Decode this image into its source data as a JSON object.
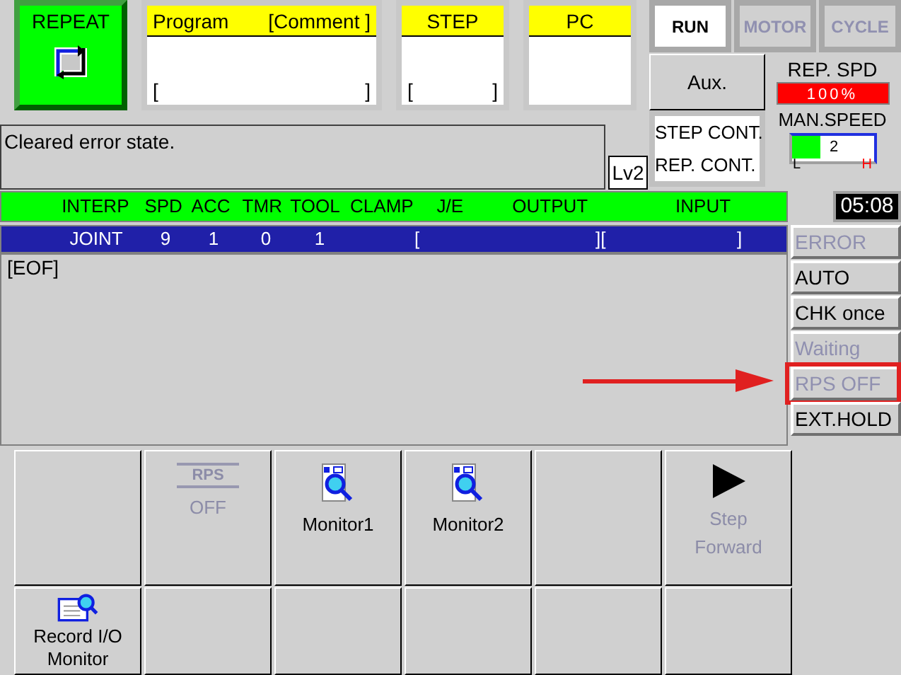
{
  "mode": {
    "label": "REPEAT"
  },
  "fields": [
    {
      "title": "Program",
      "comment": "[Comment ]",
      "open": "[",
      "close": "]"
    },
    {
      "title": "STEP",
      "open": "[",
      "close": "]"
    },
    {
      "title": "PC"
    }
  ],
  "status_buttons": [
    {
      "label": "RUN",
      "active": true
    },
    {
      "label": "MOTOR",
      "active": false
    },
    {
      "label": "CYCLE",
      "active": false
    }
  ],
  "aux": "Aux.",
  "cont_modes": [
    "STEP CONT.",
    "REP. CONT."
  ],
  "rep_speed": {
    "label": "REP. SPD",
    "value": "100%"
  },
  "man_speed": {
    "label": "MAN.SPEED",
    "value": "2",
    "level": 0.35,
    "low": "L",
    "high": "H"
  },
  "message": "Cleared error state.",
  "user_level": "Lv2",
  "table": {
    "columns": [
      "INTERP",
      "SPD",
      "ACC",
      "TMR",
      "TOOL",
      "CLAMP",
      "J/E",
      "OUTPUT",
      "INPUT"
    ],
    "row": {
      "cells": [
        "JOINT",
        "9",
        "1",
        "0",
        "1"
      ],
      "brackets": [
        "[",
        "][",
        "]"
      ]
    },
    "end": "[EOF]"
  },
  "clock": "05:08",
  "indicators": [
    {
      "label": "ERROR",
      "enabled": false,
      "highlighted": false
    },
    {
      "label": "AUTO",
      "enabled": true,
      "highlighted": false
    },
    {
      "label": "CHK once",
      "enabled": true,
      "highlighted": false
    },
    {
      "label": "Waiting",
      "enabled": false,
      "highlighted": false
    },
    {
      "label": "RPS OFF",
      "enabled": false,
      "highlighted": true
    },
    {
      "label": "EXT.HOLD",
      "enabled": true,
      "highlighted": false
    }
  ],
  "softkeys_top": [
    {
      "kind": "blank"
    },
    {
      "kind": "rps",
      "icon_text": "RPS",
      "label": "OFF",
      "disabled": true
    },
    {
      "kind": "monitor",
      "label": "Monitor1",
      "disabled": false
    },
    {
      "kind": "monitor",
      "label": "Monitor2",
      "disabled": false
    },
    {
      "kind": "blank"
    },
    {
      "kind": "step",
      "label": "Step Forward",
      "disabled": true
    }
  ],
  "softkeys_bottom": [
    {
      "kind": "record",
      "label": "Record I/O Monitor",
      "disabled": false
    },
    {
      "kind": "blank"
    },
    {
      "kind": "blank"
    },
    {
      "kind": "blank"
    },
    {
      "kind": "blank"
    },
    {
      "kind": "blank"
    }
  ]
}
